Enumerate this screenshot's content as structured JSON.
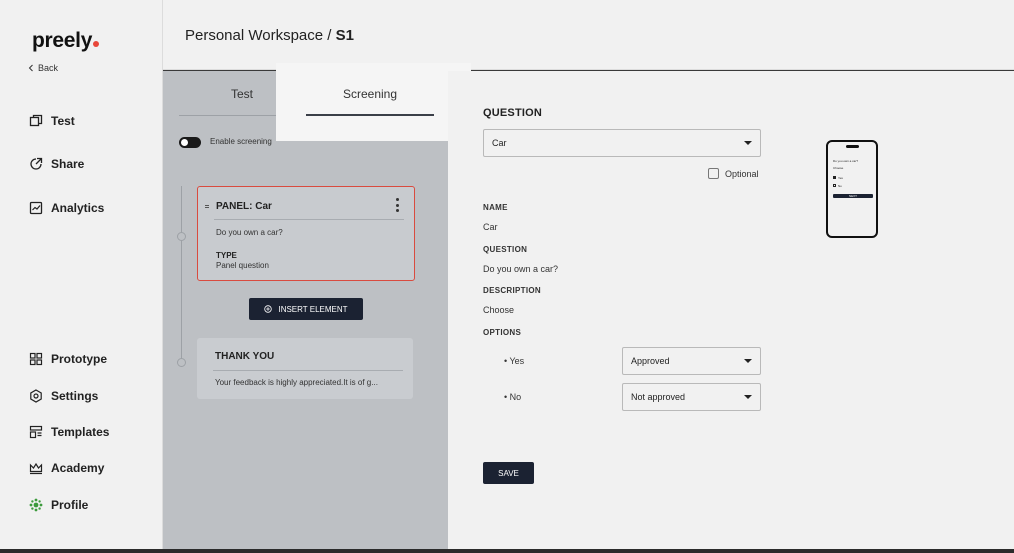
{
  "app": {
    "logo": "preely",
    "back_label": "Back",
    "accent_color": "#e8473a"
  },
  "sidebar": {
    "top_items": [
      {
        "label": "Test",
        "icon": "test-icon"
      },
      {
        "label": "Share",
        "icon": "share-icon"
      },
      {
        "label": "Analytics",
        "icon": "analytics-icon"
      }
    ],
    "bottom_items": [
      {
        "label": "Prototype",
        "icon": "prototype-icon"
      },
      {
        "label": "Settings",
        "icon": "settings-icon"
      },
      {
        "label": "Templates",
        "icon": "templates-icon"
      },
      {
        "label": "Academy",
        "icon": "academy-icon"
      },
      {
        "label": "Profile",
        "icon": "profile-icon"
      }
    ]
  },
  "header": {
    "breadcrumb_workspace": "Personal Workspace /",
    "breadcrumb_current": "S1"
  },
  "tabs": [
    {
      "label": "Test"
    },
    {
      "label": "Screening",
      "active": true
    }
  ],
  "screening": {
    "toggle_label": "Enable screening",
    "panel_card": {
      "title": "PANEL:  Car",
      "question": "Do you own a car?",
      "type_label": "TYPE",
      "type_value": "Panel question"
    },
    "insert_label": "INSERT ELEMENT",
    "thank_card": {
      "title": "THANK YOU",
      "text": "Your feedback is highly appreciated.It is of g..."
    }
  },
  "question_panel": {
    "title": "QUESTION",
    "selected": "Car",
    "optional_label": "Optional",
    "name_label": "NAME",
    "name_value": "Car",
    "question_label": "QUESTION",
    "question_value": "Do you own a car?",
    "description_label": "DESCRIPTION",
    "description_value": "Choose",
    "options_label": "OPTIONS",
    "options": [
      {
        "label": "• Yes",
        "status": "Approved"
      },
      {
        "label": "• No",
        "status": "Not approved"
      }
    ],
    "save_label": "SAVE"
  },
  "phone_preview": {
    "question": "Do you own a car?",
    "description": "Choose",
    "option_yes": "Yes",
    "option_no": "No",
    "button": "NEXT"
  }
}
